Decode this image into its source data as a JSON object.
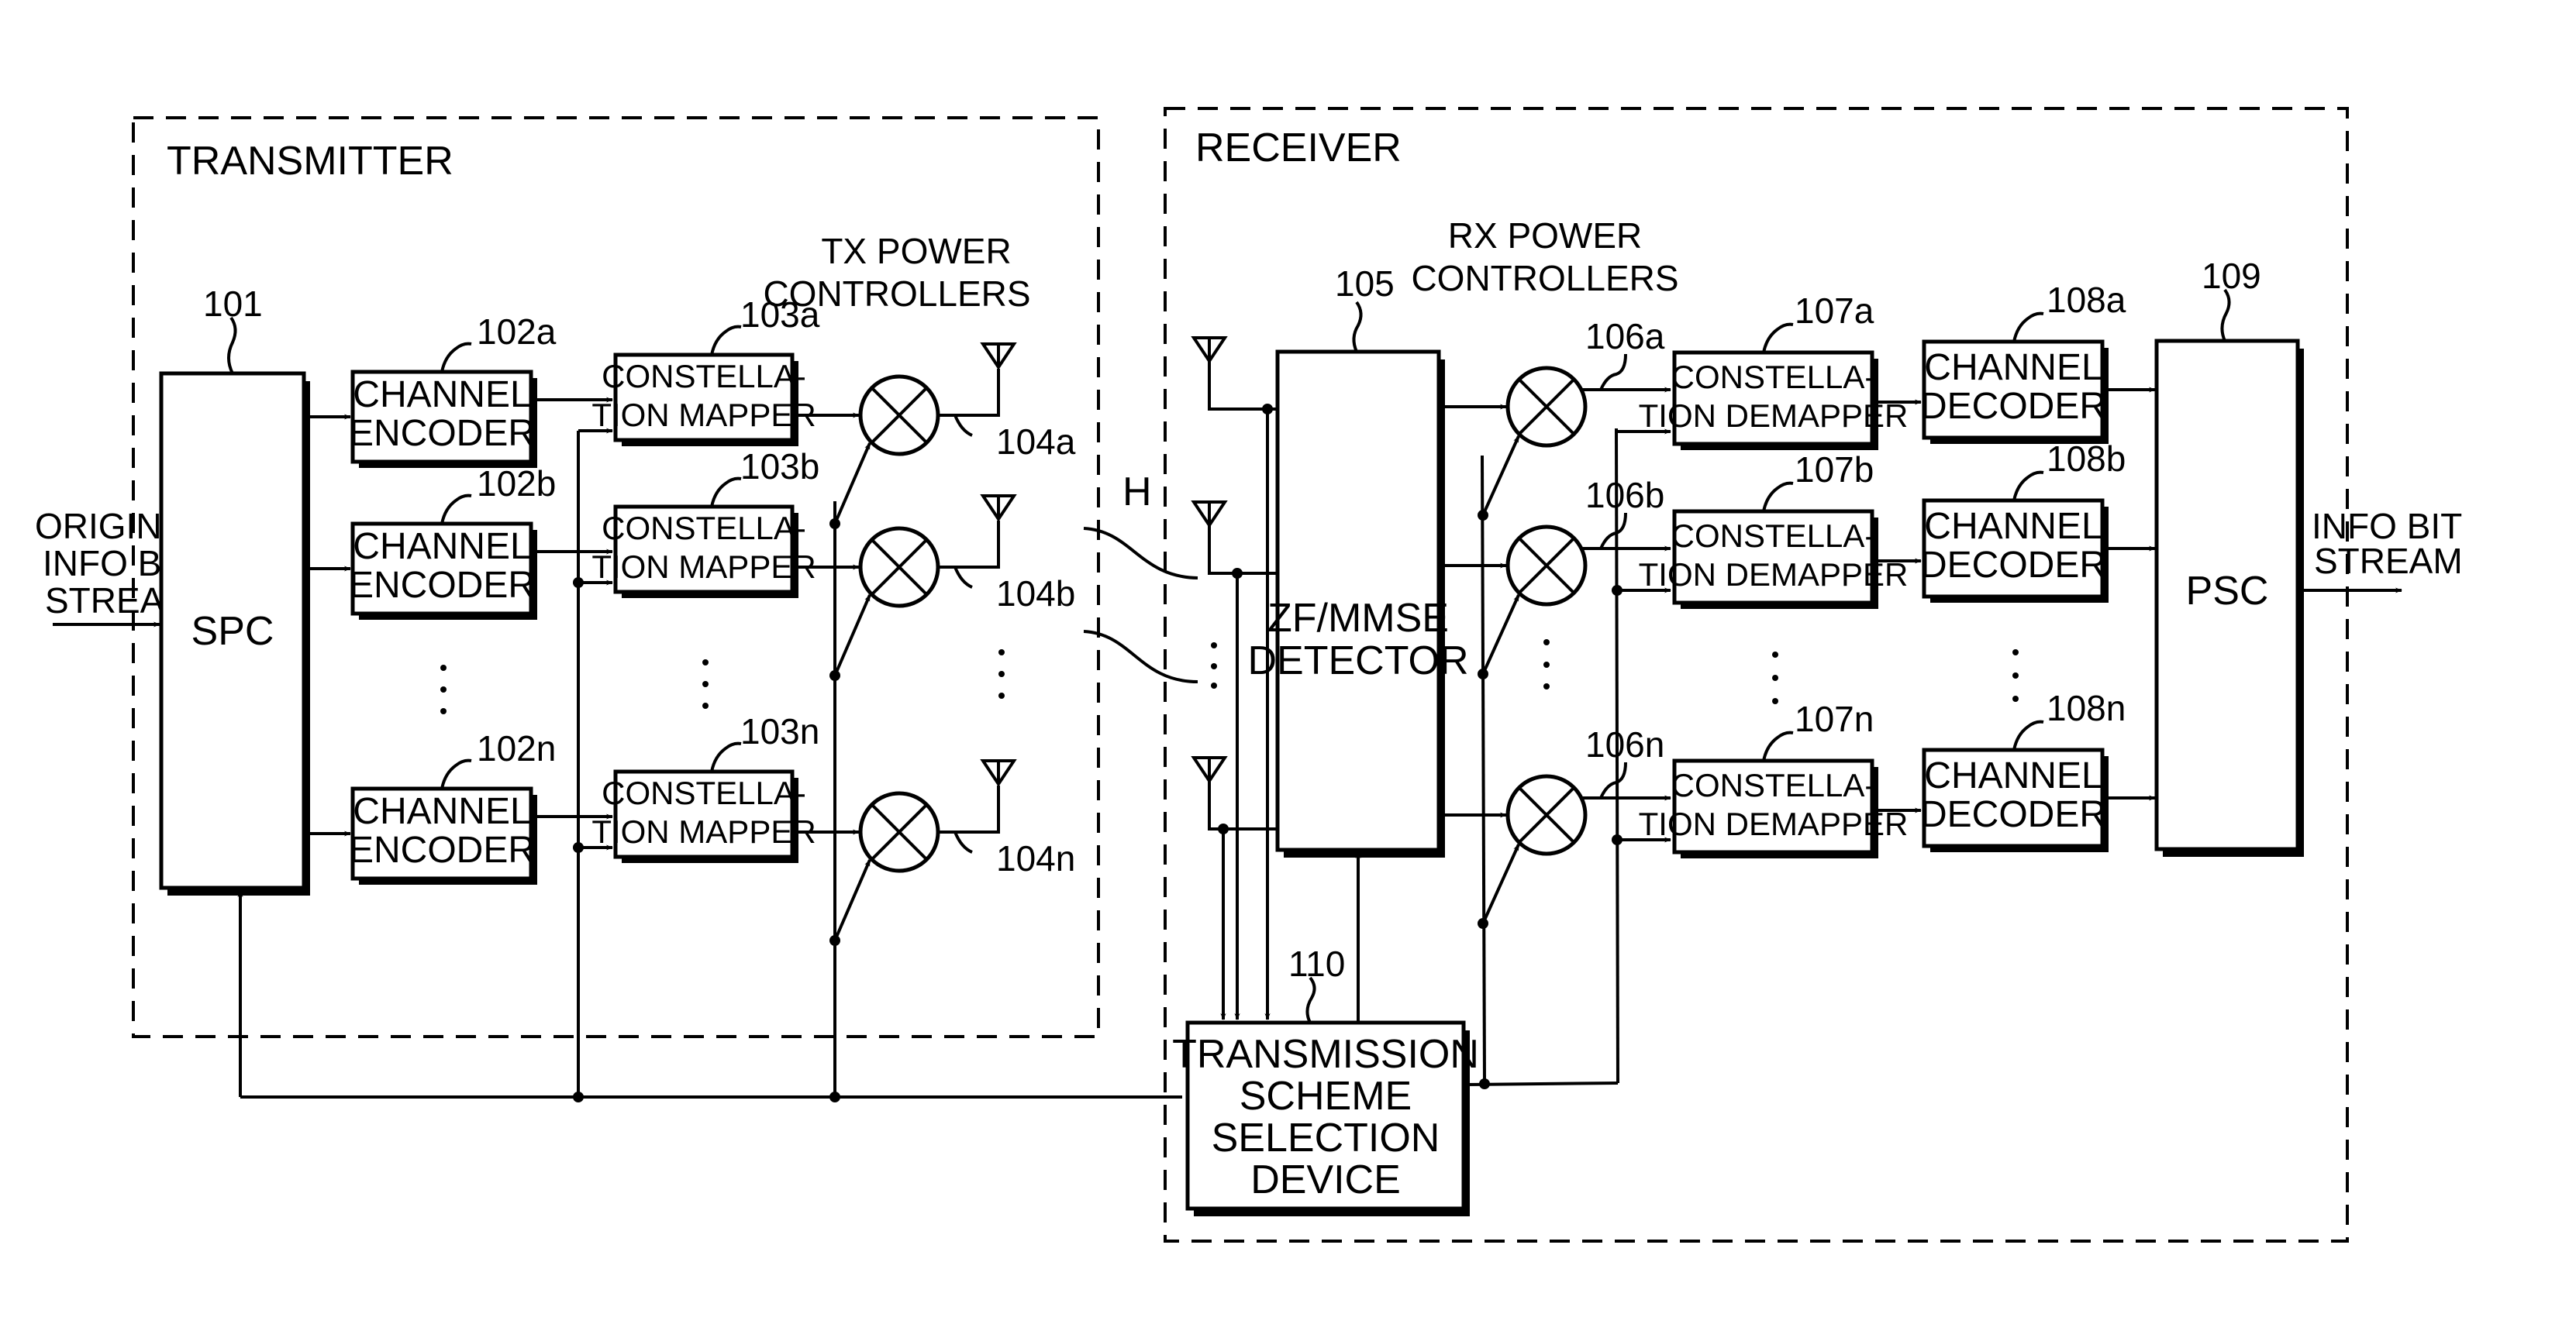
{
  "transmitter": {
    "title": "TRANSMITTER",
    "spc": {
      "ref": "101",
      "label": "SPC"
    },
    "input_label": [
      "ORIGINAL",
      "INFO BIT",
      "STREAM"
    ],
    "tx_power_label": [
      "TX POWER",
      "CONTROLLERS"
    ],
    "rows": [
      {
        "encoder_ref": "102a",
        "encoder_label": [
          "CHANNEL",
          "ENCODER"
        ],
        "mapper_ref": "103a",
        "mapper_label": [
          "CONSTELLA-",
          "TION MAPPER"
        ],
        "power_ref": "104a"
      },
      {
        "encoder_ref": "102b",
        "encoder_label": [
          "CHANNEL",
          "ENCODER"
        ],
        "mapper_ref": "103b",
        "mapper_label": [
          "CONSTELLA-",
          "TION MAPPER"
        ],
        "power_ref": "104b"
      },
      {
        "encoder_ref": "102n",
        "encoder_label": [
          "CHANNEL",
          "ENCODER"
        ],
        "mapper_ref": "103n",
        "mapper_label": [
          "CONSTELLA-",
          "TION MAPPER"
        ],
        "power_ref": "104n"
      }
    ]
  },
  "channel": {
    "label": "H"
  },
  "receiver": {
    "title": "RECEIVER",
    "detector": {
      "ref": "105",
      "label": [
        "ZF/MMSE",
        "DETECTOR"
      ]
    },
    "rx_power_label": [
      "RX POWER",
      "CONTROLLERS"
    ],
    "rows": [
      {
        "power_ref": "106a",
        "demapper_ref": "107a",
        "demapper_label": [
          "CONSTELLA-",
          "TION DEMAPPER"
        ],
        "decoder_ref": "108a",
        "decoder_label": [
          "CHANNEL",
          "DECODER"
        ]
      },
      {
        "power_ref": "106b",
        "demapper_ref": "107b",
        "demapper_label": [
          "CONSTELLA-",
          "TION DEMAPPER"
        ],
        "decoder_ref": "108b",
        "decoder_label": [
          "CHANNEL",
          "DECODER"
        ]
      },
      {
        "power_ref": "106n",
        "demapper_ref": "107n",
        "demapper_label": [
          "CONSTELLA-",
          "TION DEMAPPER"
        ],
        "decoder_ref": "108n",
        "decoder_label": [
          "CHANNEL",
          "DECODER"
        ]
      }
    ],
    "psc": {
      "ref": "109",
      "label": "PSC"
    },
    "output_label": [
      "INFO BIT",
      "STREAM"
    ],
    "tssd": {
      "ref": "110",
      "label": [
        "TRANSMISSION",
        "SCHEME",
        "SELECTION",
        "DEVICE"
      ]
    }
  }
}
